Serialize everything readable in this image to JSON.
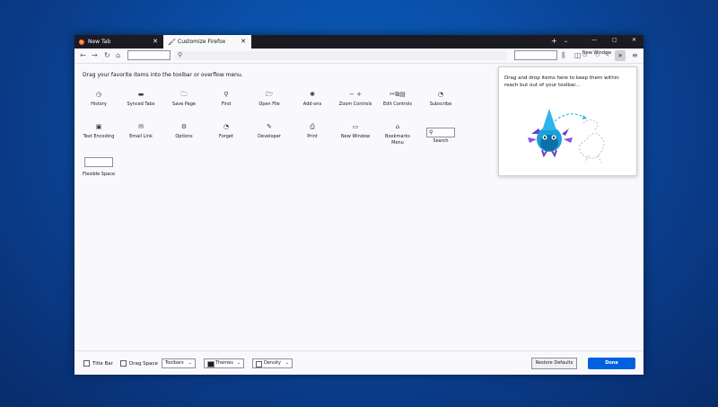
{
  "tabs": [
    {
      "label": "New Tab",
      "close": "✕"
    },
    {
      "label": "Customize Firefox",
      "close": "✕"
    }
  ],
  "titlebar": {
    "new_tab": "+",
    "list_all": "⌄",
    "minimize": "—",
    "maximize": "▢",
    "close": "✕"
  },
  "toolbar": {
    "back": "←",
    "forward": "→",
    "reload": "↻",
    "home": "⌂",
    "library": "⫼",
    "sidebar": "◫",
    "new_window_label": "New Window",
    "overflow": "»",
    "menu": "≡"
  },
  "palette": {
    "instructions": "Drag your favorite items into the toolbar or overflow menu.",
    "items": [
      {
        "label": "History",
        "icon": "◷"
      },
      {
        "label": "Synced Tabs",
        "icon": "▬"
      },
      {
        "label": "Save Page",
        "icon": "🗀"
      },
      {
        "label": "Find",
        "icon": "⚲"
      },
      {
        "label": "Open File",
        "icon": "🗁"
      },
      {
        "label": "Add-ons",
        "icon": "✱"
      },
      {
        "label": "Zoom Controls",
        "icon": "− +"
      },
      {
        "label": "Edit Controls",
        "icon": "✂⧉▤"
      },
      {
        "label": "Subscribe",
        "icon": "◔"
      },
      {
        "label": "Text Encoding",
        "icon": "▣"
      },
      {
        "label": "Email Link",
        "icon": "✉"
      },
      {
        "label": "Options",
        "icon": "⚙"
      },
      {
        "label": "Forget",
        "icon": "◔"
      },
      {
        "label": "Developer",
        "icon": "✎"
      },
      {
        "label": "Print",
        "icon": "⎙"
      },
      {
        "label": "New Window",
        "icon": "▭"
      },
      {
        "label": "Bookmarks Menu",
        "icon": "⌂"
      },
      {
        "label": "Search",
        "icon": "⚲"
      },
      {
        "label": "Flexible Space",
        "icon": ""
      }
    ]
  },
  "overflow_panel": {
    "text": "Drag and drop items here to keep them within reach but out of your toolbar..."
  },
  "bottom": {
    "title_bar": "Title Bar",
    "drag_space": "Drag Space",
    "toolbars": "Toolbars",
    "themes": "Themes",
    "density": "Density",
    "restore": "Restore Defaults",
    "done": "Done"
  }
}
